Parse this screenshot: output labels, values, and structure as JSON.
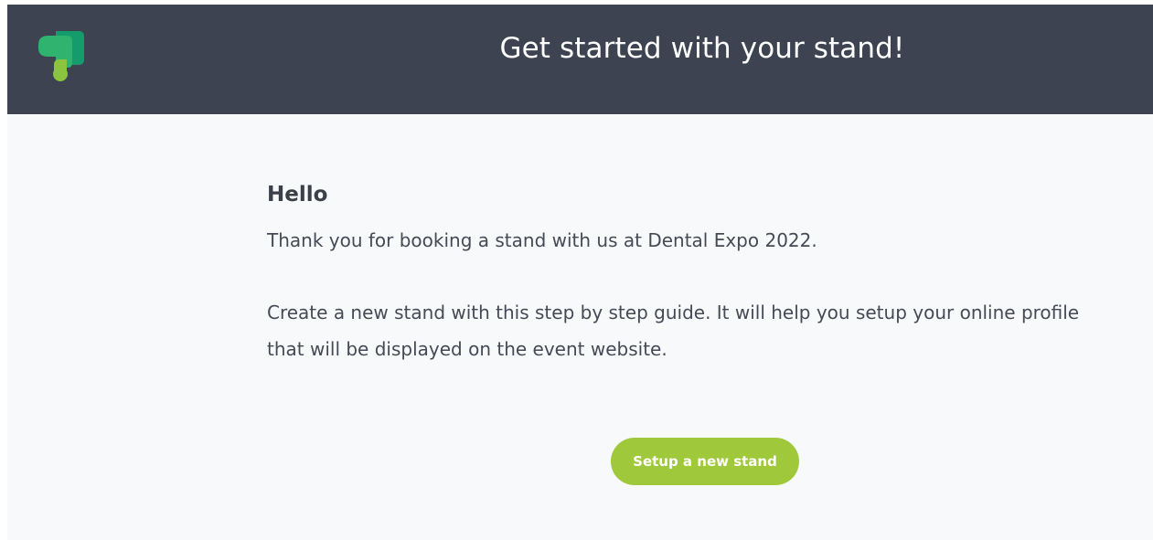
{
  "header": {
    "title": "Get started with your stand!"
  },
  "message": {
    "greeting": "Hello",
    "intro": "Thank you for booking a stand with us at Dental Expo 2022.",
    "guide": "Create a new stand with this step by step guide. It will help you setup your online profile that will be displayed on the event website."
  },
  "actions": {
    "setup_label": "Setup a new stand"
  },
  "colors": {
    "header_background": "#3d4350",
    "page_background": "#f8f9fb",
    "button": "#9fc83b",
    "logo_green_dark": "#159c6c",
    "logo_green_mid": "#2fb36e",
    "logo_green_light": "#8bc43f"
  },
  "icons": {
    "logo": "brand-logo-icon"
  }
}
